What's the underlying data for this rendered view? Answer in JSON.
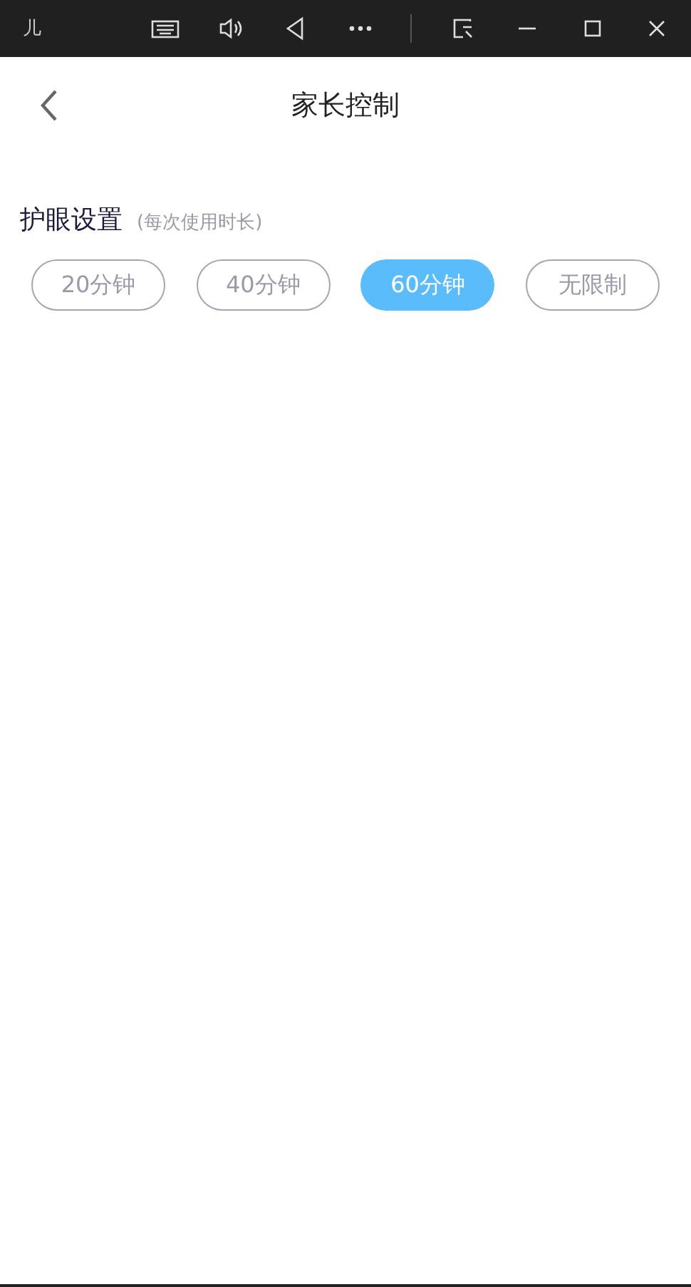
{
  "window": {
    "title": "儿"
  },
  "header": {
    "title": "家长控制"
  },
  "eye_care": {
    "title": "护眼设置",
    "hint": "(每次使用时长)",
    "options": [
      {
        "label": "20分钟",
        "selected": false
      },
      {
        "label": "40分钟",
        "selected": false
      },
      {
        "label": "60分钟",
        "selected": true
      },
      {
        "label": "无限制",
        "selected": false
      }
    ]
  }
}
